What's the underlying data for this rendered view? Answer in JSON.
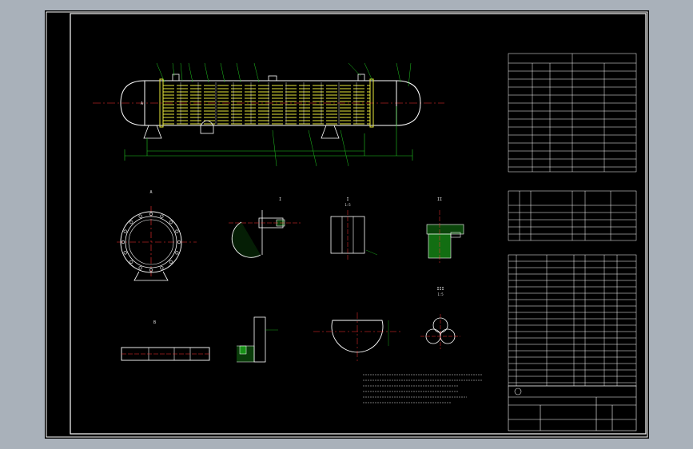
{
  "colors": {
    "background": "#000000",
    "frame": "#ffffff",
    "shell": "#ffffff",
    "tubes": "#e8e83a",
    "center": "#ff3030",
    "dimension": "#20c820",
    "hatch": "#20c820",
    "text": "#e8e8e8"
  },
  "views": {
    "section_a": "A",
    "section_b": "B",
    "detail_1": "I",
    "detail_1_scale": "1:5",
    "detail_2": "II",
    "detail_3": "III",
    "detail_3_scale": "1:5"
  }
}
